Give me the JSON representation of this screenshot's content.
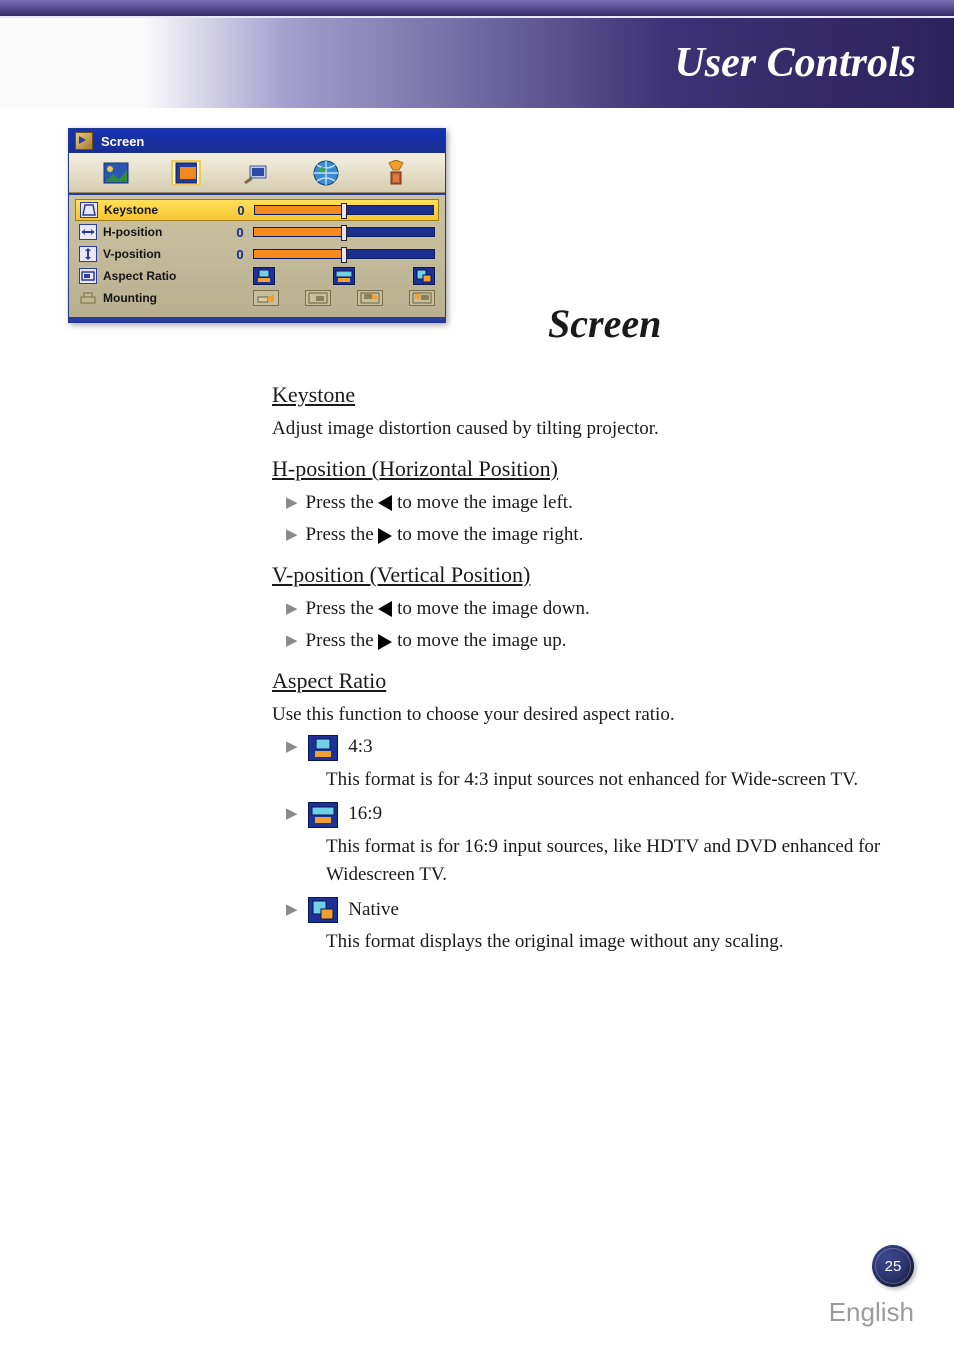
{
  "header": {
    "title": "User Controls"
  },
  "osd": {
    "windowTitle": "Screen",
    "rows": {
      "keystone": {
        "label": "Keystone",
        "value": "0"
      },
      "hpos": {
        "label": "H-position",
        "value": "0"
      },
      "vpos": {
        "label": "V-position",
        "value": "0"
      },
      "aspect": {
        "label": "Aspect Ratio"
      },
      "mount": {
        "label": "Mounting"
      }
    }
  },
  "mainHeading": "Screen",
  "sections": {
    "keystone": {
      "title": "Keystone",
      "desc": "Adjust image distortion caused by tilting projector."
    },
    "hpos": {
      "title": "H-position (Horizontal Position)",
      "b1a": "Press the ",
      "b1b": " to move the image left.",
      "b2a": "Press the ",
      "b2b": " to move the image right."
    },
    "vpos": {
      "title": "V-position (Vertical Position)",
      "b1a": "Press the ",
      "b1b": " to move the image down.",
      "b2a": "Press the ",
      "b2b": " to move the image up."
    },
    "aspect": {
      "title": "Aspect Ratio",
      "desc": "Use this function to choose your desired aspect ratio.",
      "r43_label": "4:3",
      "r43_desc": "This format is for 4:3 input sources not enhanced for Wide-screen TV.",
      "r169_label": "16:9",
      "r169_desc": "This format is for 16:9 input sources, like HDTV and DVD enhanced for Widescreen TV.",
      "native_label": "Native",
      "native_desc": "This format displays the original image without any scaling."
    }
  },
  "footer": {
    "page": "25",
    "language": "English"
  }
}
